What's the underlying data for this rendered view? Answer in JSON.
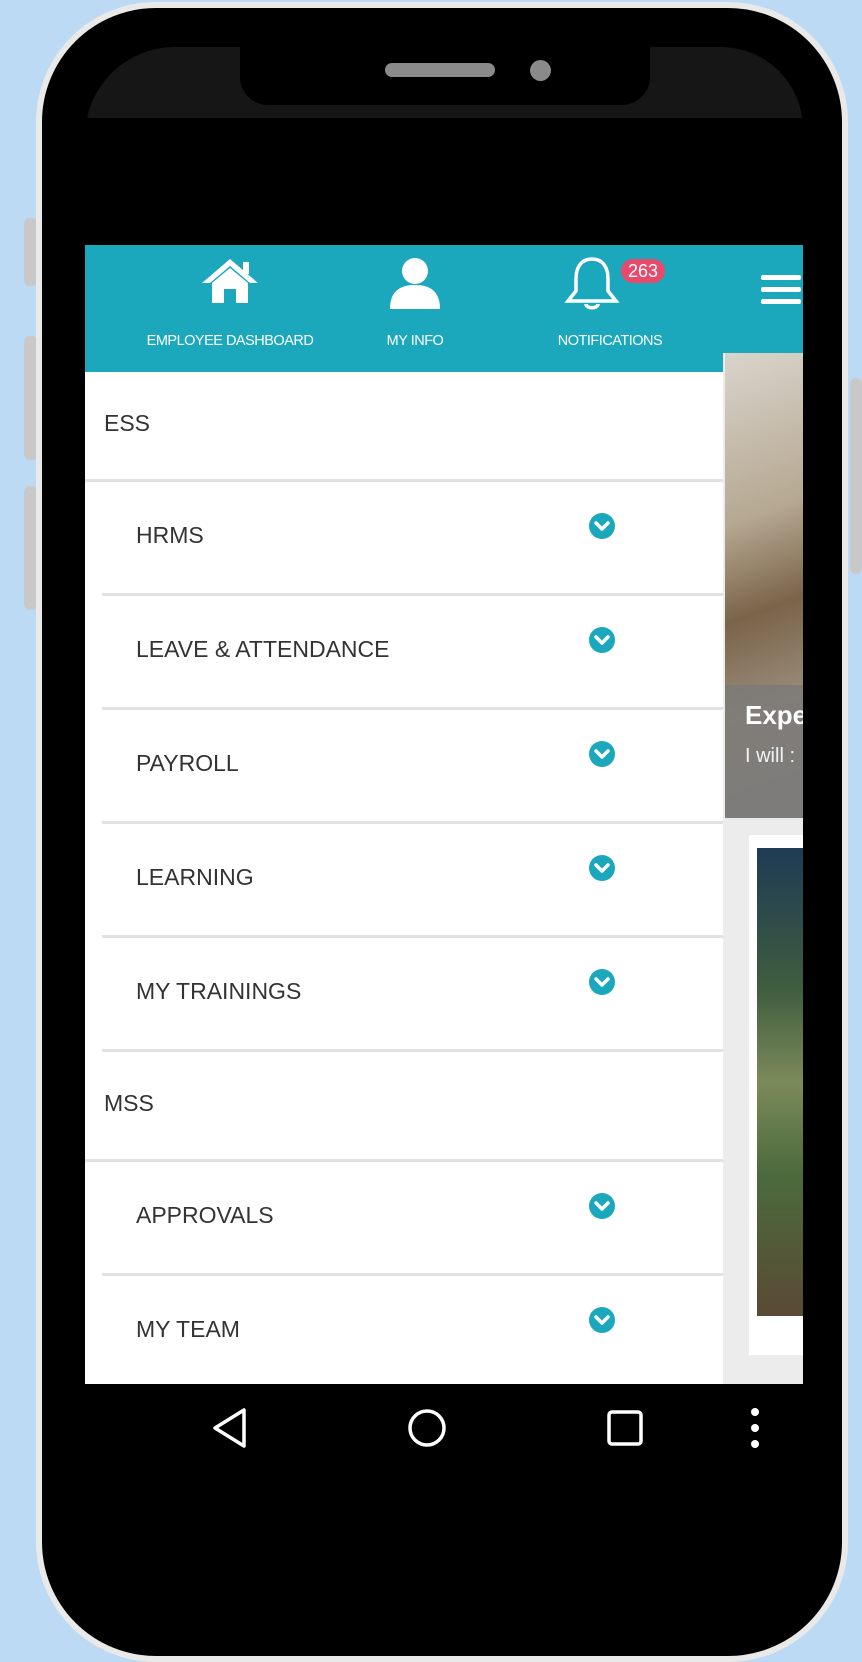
{
  "colors": {
    "page_background": "#bcdaf4",
    "header": "#1ba8bc",
    "badge": "#e84a6c",
    "chevron": "#1ba8bc",
    "menu_text": "#333333"
  },
  "topbar": {
    "items": [
      {
        "label": "EMPLOYEE DASHBOARD",
        "icon": "home-icon"
      },
      {
        "label": "MY INFO",
        "icon": "user-icon"
      },
      {
        "label": "NOTIFICATIONS",
        "icon": "bell-icon",
        "badge": "263"
      }
    ],
    "menu_icon": "hamburger-icon"
  },
  "menu": {
    "sections": [
      {
        "title": "ESS",
        "items": [
          "HRMS",
          "LEAVE & ATTENDANCE",
          "PAYROLL",
          "LEARNING",
          "MY TRAININGS"
        ]
      },
      {
        "title": "MSS",
        "items": [
          "APPROVALS",
          "MY TEAM"
        ]
      }
    ],
    "item_icon": "chevron-down-circle-icon"
  },
  "background_content": {
    "card_title": "Expe",
    "card_text": "I will :"
  },
  "navigation_bar": {
    "buttons": [
      "back-icon",
      "home-circle-icon",
      "recents-icon",
      "more-vert-icon"
    ]
  }
}
